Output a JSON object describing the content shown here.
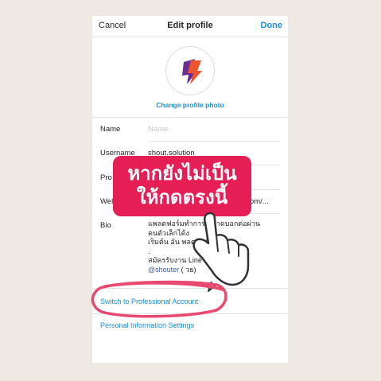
{
  "navbar": {
    "cancel_label": "Cancel",
    "title": "Edit profile",
    "done_label": "Done"
  },
  "profile_photo": {
    "change_label": "Change profile photo",
    "brand_colors": [
      "#6b2d91",
      "#f0522a"
    ]
  },
  "fields": {
    "name": {
      "label": "Name",
      "placeholder": "Name"
    },
    "username": {
      "label": "Username",
      "value": "shout.solution"
    },
    "pronouns": {
      "label": "Pro"
    },
    "website": {
      "label": "Wel",
      "value": "on.com/..."
    },
    "bio": {
      "label": "Bio",
      "lines": [
        "แพลตฟอร์มทำการ      ตลาดบอกต่อผ่าน",
        "คนตัวเล็กได้ง",
        "เริ่มต้น อัน          พลตฟอร์ม",
        ".",
        "สมัครรับงาน                Line :"
      ],
      "mention": "@shouter",
      "mention_suffix": " (              วย)"
    }
  },
  "links": {
    "professional": "Switch to Professional Account",
    "personal_info": "Personal Information Settings"
  },
  "overlay": {
    "banner_line1": "หากยังไม่เป็น",
    "banner_line2": "ให้กดตรงนี้",
    "banner_color": "#e51e55",
    "highlight_color": "#e8496e"
  }
}
